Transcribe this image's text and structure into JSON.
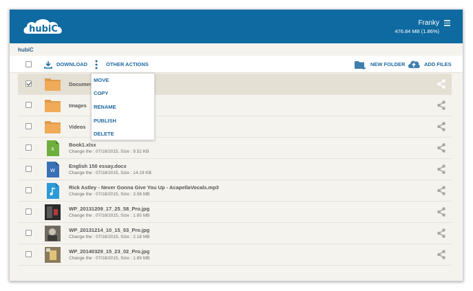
{
  "header": {
    "logo_text": "hubiC",
    "user_name": "Franky",
    "quota": "476.84 MB (1.86%)",
    "menu_icon": "hamburger-icon",
    "background": "#0e6aa1"
  },
  "breadcrumb": "hubiC",
  "toolbar": {
    "download_label": "DOWNLOAD",
    "other_actions_label": "OTHER ACTIONS",
    "new_folder_label": "NEW FOLDER",
    "add_files_label": "ADD FILES",
    "accent": "#1f6aa0"
  },
  "menu": {
    "items": [
      "MOVE",
      "COPY",
      "RENAME",
      "PUBLISH",
      "DELETE"
    ]
  },
  "files": [
    {
      "name": "Documen",
      "type": "folder",
      "selected": true
    },
    {
      "name": "Images",
      "type": "folder",
      "selected": false
    },
    {
      "name": "Videos",
      "type": "folder",
      "selected": false
    },
    {
      "name": "Book1.xlsx",
      "type": "xlsx",
      "meta": "Change the  : 07/18/2015, Size  : 9.52 KB"
    },
    {
      "name": "English 150 essay.docx",
      "type": "docx",
      "meta": "Change the  : 07/18/2015, Size  : 14.19 KB"
    },
    {
      "name": "Rick Astley - Never Gonna Give You Up - AcapellaVocals.mp3",
      "type": "mp3",
      "meta": "Change the  : 07/18/2015, Size  : 3.08 MB"
    },
    {
      "name": "WP_20131209_17_25_58_Pro.jpg",
      "type": "jpg",
      "meta": "Change the  : 07/18/2015, Size  : 1.65 MB"
    },
    {
      "name": "WP_20131214_10_15_53_Pro.jpg",
      "type": "jpg",
      "meta": "Change the  : 07/18/2015, Size  : 2.18 MB"
    },
    {
      "name": "WP_20140329_15_23_02_Pro.jpg",
      "type": "jpg",
      "meta": "Change the  : 07/18/2015, Size  : 1.89 MB"
    }
  ],
  "icons": {
    "share": "share-icon",
    "folder": "folder-icon",
    "xlsx": "excel-file-icon",
    "docx": "word-file-icon",
    "mp3": "audio-file-icon",
    "jpg": "image-thumbnail"
  }
}
